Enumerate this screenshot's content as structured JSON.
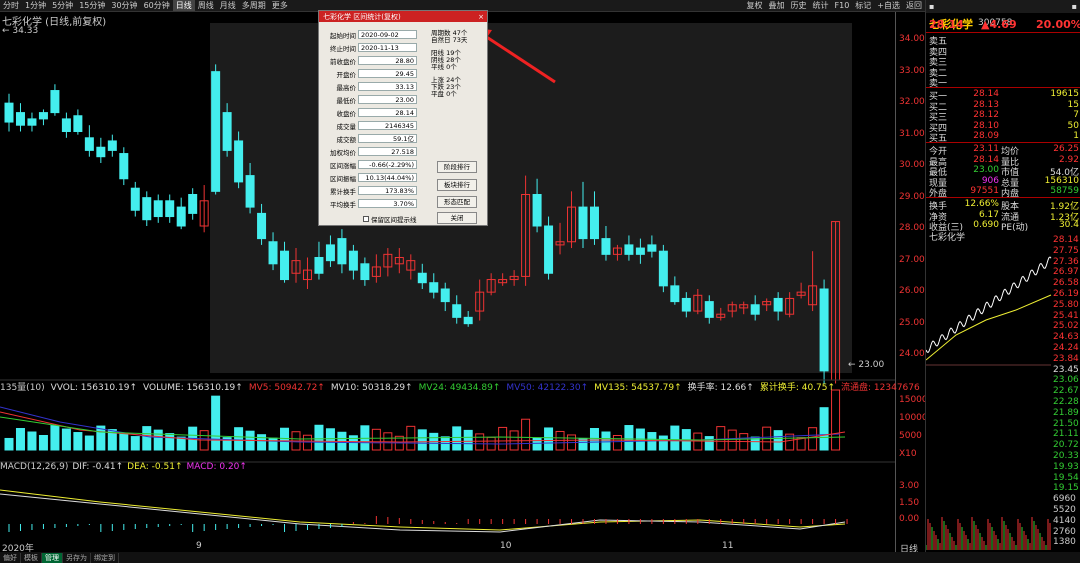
{
  "toolbar": {
    "items": [
      "分时",
      "1分钟",
      "5分钟",
      "15分钟",
      "30分钟",
      "60分钟",
      "日线",
      "周线",
      "月线",
      "多周期",
      "更多"
    ],
    "right": [
      "复权",
      "叠加",
      "历史",
      "统计",
      "F10",
      "标记",
      "+自选",
      "返回"
    ]
  },
  "chart": {
    "title": "七彩化学 (日线,前复权)",
    "high_label": "34.33",
    "low_label": "23.00",
    "price_axis": [
      "34.00",
      "33.00",
      "32.00",
      "31.00",
      "30.00",
      "29.00",
      "28.00",
      "27.00",
      "26.00",
      "25.00",
      "24.00"
    ],
    "date_labels": [
      "2020年",
      "9",
      "10",
      "11"
    ],
    "right_label": "日线"
  },
  "volume": {
    "header": [
      "135量(10)",
      "VVOL: 156310.19↑",
      "VOLUME: 156310.19↑",
      "MV5: 50942.72↑",
      "MV10: 50318.29↑",
      "MV24: 49434.89↑",
      "MV50: 42122.30↑",
      "MV135: 54537.79↑",
      "换手率: 12.66↑",
      "累计换手: 40.75↑",
      "流通盘: 12347676"
    ],
    "axis": [
      "15000",
      "10000",
      "5000",
      "X10"
    ]
  },
  "macd": {
    "header": [
      "MACD(12,26,9)",
      "DIF: -0.41↑",
      "DEA: -0.51↑",
      "MACD: 0.20↑"
    ],
    "axis": [
      "3.00",
      "1.50",
      "0.00"
    ]
  },
  "dialog": {
    "title": "七彩化学 区间统计(复权)",
    "close": "×",
    "rows": [
      [
        "起始时间",
        "2020-09-02"
      ],
      [
        "终止时间",
        "2020-11-13"
      ],
      [
        "前收盘价",
        "28.80"
      ],
      [
        "开盘价",
        "29.45"
      ],
      [
        "最高价",
        "33.13"
      ],
      [
        "最低价",
        "23.00"
      ],
      [
        "收盘价",
        "28.14"
      ],
      [
        "成交量",
        "2146345"
      ],
      [
        "成交额",
        "59.1亿"
      ],
      [
        "加权均价",
        "27.518"
      ],
      [
        "区间涨幅",
        "-0.66(-2.29%)"
      ],
      [
        "区间振幅",
        "10.13(44.04%)"
      ],
      [
        "累计换手",
        "173.83%"
      ],
      [
        "平均换手",
        "3.70%"
      ]
    ],
    "stats1": [
      "周期数 47个",
      "自然日 73天"
    ],
    "stats2": [
      "阳线 19个",
      "阴线 28个",
      "平线 0个"
    ],
    "stats3": [
      "上涨 24个",
      "下跌 23个",
      "平盘 0个"
    ],
    "buttons": [
      "阶段排行",
      "板块排行",
      "形态匹配",
      "关闭"
    ],
    "checkbox": "保留区间提示线"
  },
  "quote": {
    "name": "七彩化学",
    "code": "300758",
    "price": "28.14",
    "change": "▲4.69",
    "pct": "20.00%",
    "sell": [
      [
        "卖五",
        ""
      ],
      [
        "卖四",
        ""
      ],
      [
        "卖三",
        ""
      ],
      [
        "卖二",
        ""
      ],
      [
        "卖一",
        ""
      ]
    ],
    "buy": [
      [
        "买一",
        "28.14",
        "19615"
      ],
      [
        "买二",
        "28.13",
        "15"
      ],
      [
        "买三",
        "28.12",
        "7"
      ],
      [
        "买四",
        "28.10",
        "50"
      ],
      [
        "买五",
        "28.09",
        "1"
      ]
    ],
    "stats": [
      [
        "今开",
        "23.11",
        "均价",
        "26.25"
      ],
      [
        "最高",
        "28.14",
        "量比",
        "2.92"
      ],
      [
        "最低",
        "23.00",
        "市值",
        "54.0亿"
      ],
      [
        "现量",
        "906",
        "总量",
        "156310"
      ],
      [
        "外盘",
        "97551",
        "内盘",
        "58759"
      ]
    ],
    "stats2": [
      [
        "换手",
        "12.66%",
        "股本",
        "1.92亿"
      ],
      [
        "净资",
        "6.17",
        "流通",
        "1.23亿"
      ],
      [
        "收益(三)",
        "0.690",
        "PE(动)",
        "30.4"
      ]
    ],
    "mini_title": "七彩化学",
    "mini_axis": [
      "28.14",
      "27.75",
      "27.36",
      "26.97",
      "26.58",
      "26.19",
      "25.80",
      "25.41",
      "25.02",
      "24.63",
      "24.24",
      "23.84",
      "23.45",
      "23.06",
      "22.67",
      "22.28",
      "21.89",
      "21.50",
      "21.11",
      "20.72",
      "20.33",
      "19.93",
      "19.54",
      "19.15",
      "6960",
      "5520",
      "4140",
      "2760",
      "1380"
    ]
  },
  "bottom": {
    "items": [
      "偏好",
      "模板",
      "管理",
      "另存为",
      "绑定到"
    ]
  }
}
